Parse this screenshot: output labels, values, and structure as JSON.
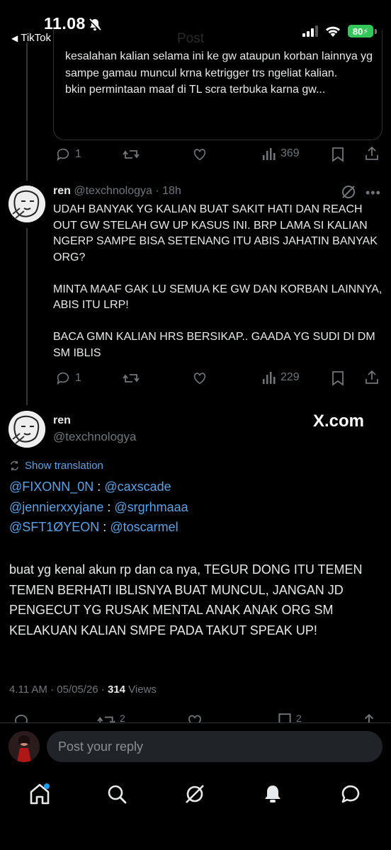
{
  "status": {
    "time": "11.08",
    "back_app": "TikTok",
    "battery": "80"
  },
  "quoted": {
    "text": "kesalahan kalian selama ini ke gw ataupun korban lainnya yg sampe gamau muncul krna ketrigger trs ngeliat kalian.\nbkin permintaan maaf di TL scra terbuka karna gw...",
    "stats": {
      "replies": "1",
      "views": "369"
    }
  },
  "reply_tweet": {
    "name": "ren",
    "handle": "@texchnologya",
    "time": "· 18h",
    "text": "UDAH BANYAK YG KALIAN BUAT SAKIT HATI DAN REACH OUT GW STELAH GW UP KASUS INI. BRP LAMA SI KALIAN NGERP SAMPE BISA SETENANG ITU ABIS JAHATIN BANYAK ORG?\n\nMINTA MAAF GAK LU SEMUA KE GW DAN KORBAN LAINNYA, ABIS ITU LRP!\n\nBACA GMN KALIAN HRS BERSIKAP.. GAADA YG SUDI DI DM SM IBLIS",
    "stats": {
      "replies": "1",
      "views": "229"
    }
  },
  "main_tweet": {
    "name": "ren",
    "handle": "@texchnologya",
    "watermark": "X.com",
    "show_translation": "Show translation",
    "mentions": [
      {
        "a": "@FIXONN_0N",
        "sep": " : ",
        "b": "@caxscade"
      },
      {
        "a": "@jennierxxyjane",
        "sep": " : ",
        "b": "@srgrhmaaa"
      },
      {
        "a": "@SFT1ØYEON",
        "sep": " : ",
        "b": "@toscarmel"
      }
    ],
    "text": "buat yg kenal akun rp dan ca nya, TEGUR DONG ITU TEMEN TEMEN BERHATI IBLISNYA BUAT MUNCUL, JANGAN JD PENGECUT YG RUSAK MENTAL ANAK ANAK ORG SM KELAKUAN KALIAN SMPE PADA TAKUT SPEAK UP!",
    "time": "4.11 AM · 05/05/26 · ",
    "views_count": "314",
    "views_label": " Views",
    "partial_stats": {
      "retweets": "2",
      "bookmarks": "2"
    }
  },
  "reply_box": {
    "placeholder": "Post your reply"
  },
  "tabs": [
    "home",
    "search",
    "grok",
    "notifications",
    "messages"
  ],
  "colors": {
    "link": "#5aa3ea",
    "muted": "#71767b",
    "battery": "#34c759"
  }
}
